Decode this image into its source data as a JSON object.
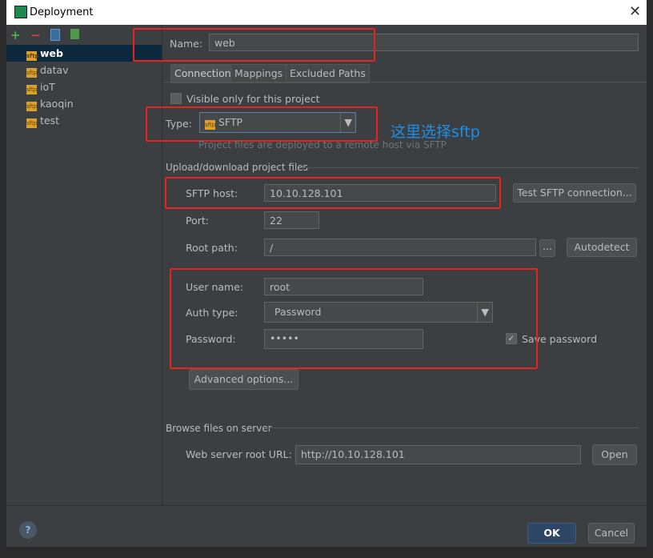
{
  "window": {
    "title": "Deployment"
  },
  "sidebar": {
    "items": [
      {
        "label": "web",
        "selected": true
      },
      {
        "label": "datav"
      },
      {
        "label": "ioT"
      },
      {
        "label": "kaoqin"
      },
      {
        "label": "test"
      }
    ]
  },
  "form": {
    "name_label": "Name:",
    "name_value": "web",
    "tabs": [
      "Connection",
      "Mappings",
      "Excluded Paths"
    ],
    "visible_only_label": "Visible only for this project",
    "visible_only_checked": false,
    "type_label": "Type:",
    "type_value": "SFTP",
    "type_hint": "Project files are deployed to a remote host via SFTP",
    "annotation": "这里选择sftp",
    "upload_section": "Upload/download project files",
    "host_label": "SFTP host:",
    "host_value": "10.10.128.101",
    "test_button": "Test SFTP connection...",
    "port_label": "Port:",
    "port_value": "22",
    "root_label": "Root path:",
    "root_value": "/",
    "browse_button": "...",
    "autodetect_button": "Autodetect",
    "user_label": "User name:",
    "user_value": "root",
    "auth_label": "Auth type:",
    "auth_value": "Password",
    "password_label": "Password:",
    "password_value": "•••••",
    "save_password_label": "Save password",
    "save_password_checked": true,
    "advanced_button": "Advanced options...",
    "browse_section": "Browse files on server",
    "web_url_label": "Web server root URL:",
    "web_url_value": "http://10.10.128.101",
    "open_button": "Open"
  },
  "footer": {
    "help": "?",
    "ok": "OK",
    "cancel": "Cancel"
  },
  "colors": {
    "highlight": "#e8221e",
    "annotation": "#1e8ee8",
    "accent": "#0d293e"
  }
}
